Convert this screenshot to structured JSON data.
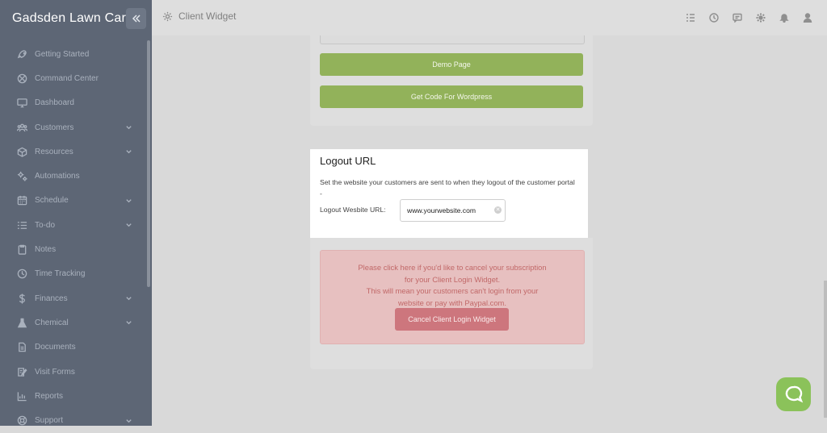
{
  "app": {
    "brand": "Gadsden Lawn Care"
  },
  "header": {
    "title": "Client Widget"
  },
  "topbar_icons": [
    "list-check-icon",
    "clock-icon",
    "message-icon",
    "gear-icon",
    "bell-icon",
    "user-icon"
  ],
  "sidebar": {
    "items": [
      {
        "label": "Getting Started",
        "icon": "rocket-icon",
        "expandable": false
      },
      {
        "label": "Command Center",
        "icon": "target-icon",
        "expandable": false
      },
      {
        "label": "Dashboard",
        "icon": "monitor-icon",
        "expandable": false
      },
      {
        "label": "Customers",
        "icon": "users-icon",
        "expandable": true
      },
      {
        "label": "Resources",
        "icon": "box-icon",
        "expandable": true
      },
      {
        "label": "Automations",
        "icon": "cogs-icon",
        "expandable": false
      },
      {
        "label": "Schedule",
        "icon": "calendar-icon",
        "expandable": true
      },
      {
        "label": "To-do",
        "icon": "list-icon",
        "expandable": true
      },
      {
        "label": "Notes",
        "icon": "clipboard-icon",
        "expandable": false
      },
      {
        "label": "Time Tracking",
        "icon": "clock-icon",
        "expandable": false
      },
      {
        "label": "Finances",
        "icon": "dollar-icon",
        "expandable": true
      },
      {
        "label": "Chemical",
        "icon": "flask-icon",
        "expandable": true
      },
      {
        "label": "Documents",
        "icon": "document-icon",
        "expandable": false
      },
      {
        "label": "Visit Forms",
        "icon": "form-icon",
        "expandable": false
      },
      {
        "label": "Reports",
        "icon": "chart-icon",
        "expandable": false
      },
      {
        "label": "Support",
        "icon": "support-icon",
        "expandable": true
      }
    ]
  },
  "widget": {
    "demo_button": "Demo Page",
    "wordpress_button": "Get Code For Wordpress"
  },
  "logout": {
    "title": "Logout URL",
    "description": "Set the website your customers are sent to when they logout of the customer portal -",
    "label": "Logout Wesbite URL:",
    "value": "www.yourwebsite.com"
  },
  "cancel": {
    "line1": "Please click here if you'd like to cancel your subscription",
    "line2": "for your Client Login Widget.",
    "line3": "This will mean your customers can't login from your",
    "line4": "website or pay with Paypal.com.",
    "button": "Cancel Client Login Widget"
  },
  "colors": {
    "sidebar": "#5d6675",
    "green": "#92b25a",
    "danger": "#cd767d",
    "chat": "#8bc25a"
  }
}
